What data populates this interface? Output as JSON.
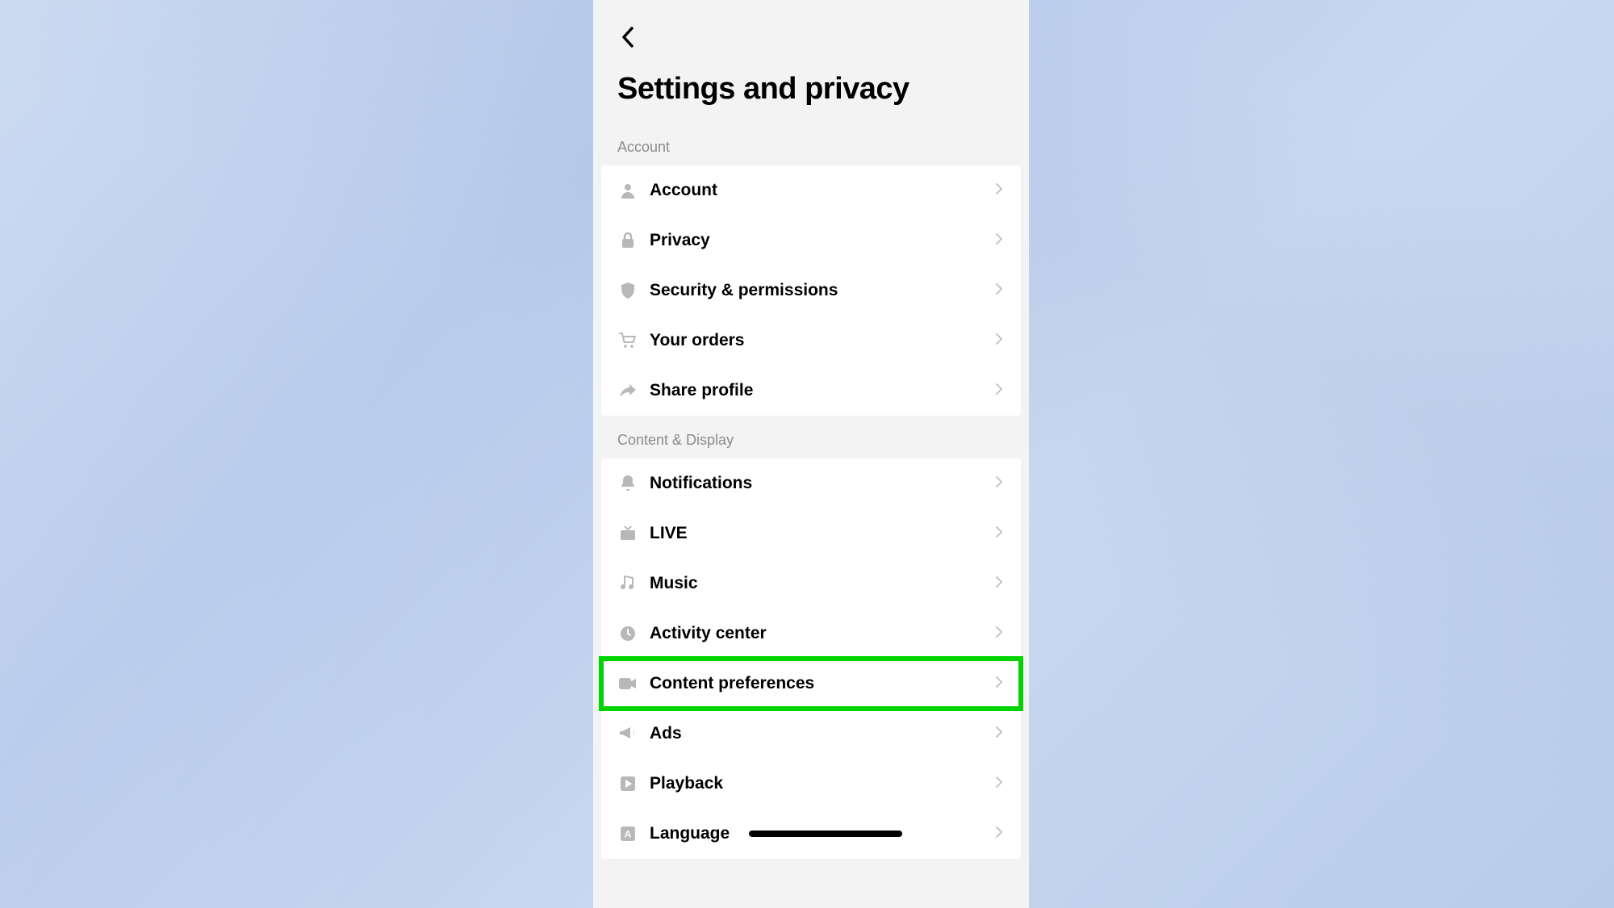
{
  "header": {
    "title": "Settings and privacy"
  },
  "sections": {
    "account": {
      "header": "Account",
      "items": [
        {
          "label": "Account",
          "icon": "person-icon"
        },
        {
          "label": "Privacy",
          "icon": "lock-icon"
        },
        {
          "label": "Security & permissions",
          "icon": "shield-icon"
        },
        {
          "label": "Your orders",
          "icon": "cart-icon"
        },
        {
          "label": "Share profile",
          "icon": "share-icon"
        }
      ]
    },
    "content_display": {
      "header": "Content & Display",
      "items": [
        {
          "label": "Notifications",
          "icon": "bell-icon"
        },
        {
          "label": "LIVE",
          "icon": "tv-icon"
        },
        {
          "label": "Music",
          "icon": "music-icon"
        },
        {
          "label": "Activity center",
          "icon": "clock-icon"
        },
        {
          "label": "Content preferences",
          "icon": "video-icon",
          "highlighted": true
        },
        {
          "label": "Ads",
          "icon": "megaphone-icon"
        },
        {
          "label": "Playback",
          "icon": "play-icon"
        },
        {
          "label": "Language",
          "icon": "letter-a-icon",
          "redacted": true
        }
      ]
    }
  },
  "highlight_color": "#00d400"
}
